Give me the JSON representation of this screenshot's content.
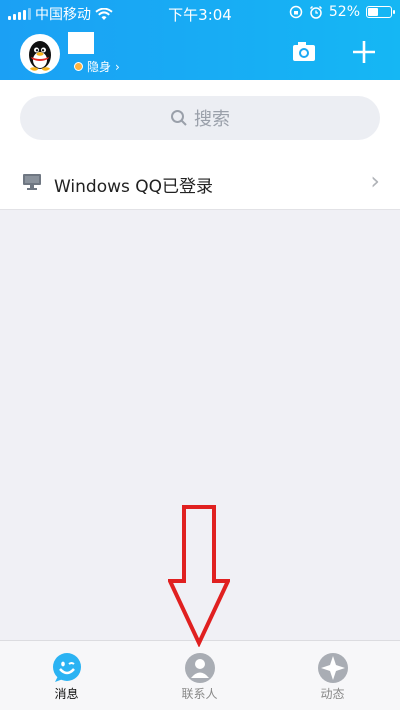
{
  "status_bar": {
    "carrier": "中国移动",
    "time": "下午3:04",
    "battery_level": 52,
    "battery": "52%"
  },
  "header": {
    "status_label": "隐身",
    "status_chevron": "›",
    "camera_icon": "camera-icon",
    "add_icon": "plus-icon",
    "accent_color": "#1ba0f4"
  },
  "search": {
    "placeholder": "搜索"
  },
  "device_notice": {
    "text": "Windows QQ已登录",
    "chevron": "›"
  },
  "tabs": [
    {
      "label": "消息",
      "icon": "message-icon",
      "active": true
    },
    {
      "label": "联系人",
      "icon": "contacts-icon",
      "active": false
    },
    {
      "label": "动态",
      "icon": "moments-icon",
      "active": false
    }
  ],
  "overlay": {
    "annotation": "red-down-arrow",
    "color": "#e02020"
  }
}
